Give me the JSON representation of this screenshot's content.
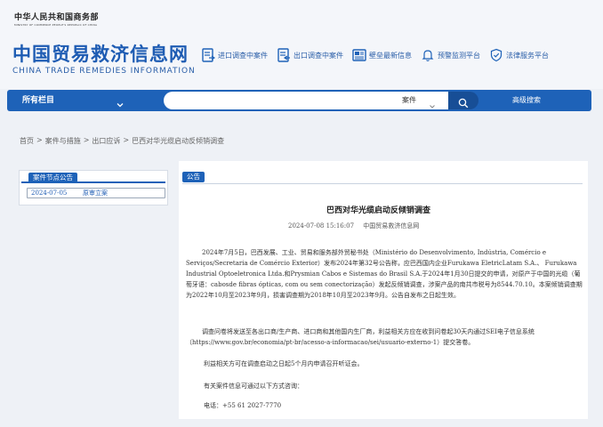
{
  "ministry": {
    "name_cn": "中华人民共和国商务部",
    "name_en": "MINISTRY OF COMMERCE PEOPLE'S REPUBLIC OF CHINA"
  },
  "site": {
    "title_cn": "中国贸易救济信息网",
    "title_en": "CHINA TRADE REMEDIES INFORMATION"
  },
  "quick_links": [
    {
      "label": "进口调查中案件",
      "icon": "import-case-icon"
    },
    {
      "label": "出口调查中案件",
      "icon": "export-case-icon"
    },
    {
      "label": "壁垒最新信息",
      "icon": "barrier-info-icon"
    },
    {
      "label": "预警监测平台",
      "icon": "bell-icon"
    },
    {
      "label": "法律服务平台",
      "icon": "shield-check-icon"
    }
  ],
  "navbar": {
    "all_columns": "所有栏目",
    "search_placeholder": "",
    "search_type": "案件",
    "advanced_search": "高级搜索"
  },
  "breadcrumb": [
    "首页",
    "案件与措施",
    "出口应诉",
    "巴西对华光缆启动反倾销调查"
  ],
  "left_panel": {
    "tag": "案件节点公告",
    "items": [
      {
        "date": "2024-07-05",
        "label": "原审立案"
      }
    ]
  },
  "article": {
    "tag": "公告",
    "title": "巴西对华光缆启动反倾销调查",
    "date": "2024-07-08 15:16:07",
    "source": "中国贸易救济信息网",
    "paragraphs": [
      "2024年7月5日，巴西发展、工业、贸易和服务部外贸秘书处（Ministério do Desenvolvimento, Indústria, Comércio e Serviços/Secretaria de Comércio Exterior）发布2024年第32号公告称，应巴西国内企业Furukawa EletricLatam S.A.、 Furukawa Industrial Optoeletronica Ltda.和Prysmian Cabos e Sistemas do Brasil S.A.于2024年1月30日提交的申请，对原产于中国的光缆（葡萄牙语：cabosde fibras ópticas, com ou sem conectorização）发起反倾销调查，涉案产品的南共市税号为8544.70.10。本案倾销调查期为2022年10月至2023年9月，损害调查期为2018年10月至2023年9月。公告自发布之日起生效。",
      "调查问卷将发送至各出口商/生产商、进口商和其他国内生厂商，利益相关方应在收到问卷起30天内通过SEI电子信息系统（https://www.gov.br/economia/pt-br/acesso-a-informacao/sei/usuario-externo-1）提交答卷。",
      "利益相关方可在调查启动之日起5个月内申请召开听证会。",
      "有关案件信息可通过以下方式咨询：",
      "电话：+55 61 2027-7770"
    ]
  },
  "colors": {
    "brand_blue": "#1e62b8",
    "logo_blue": "#1e5cb3",
    "page_bg": "#eef1f6"
  }
}
